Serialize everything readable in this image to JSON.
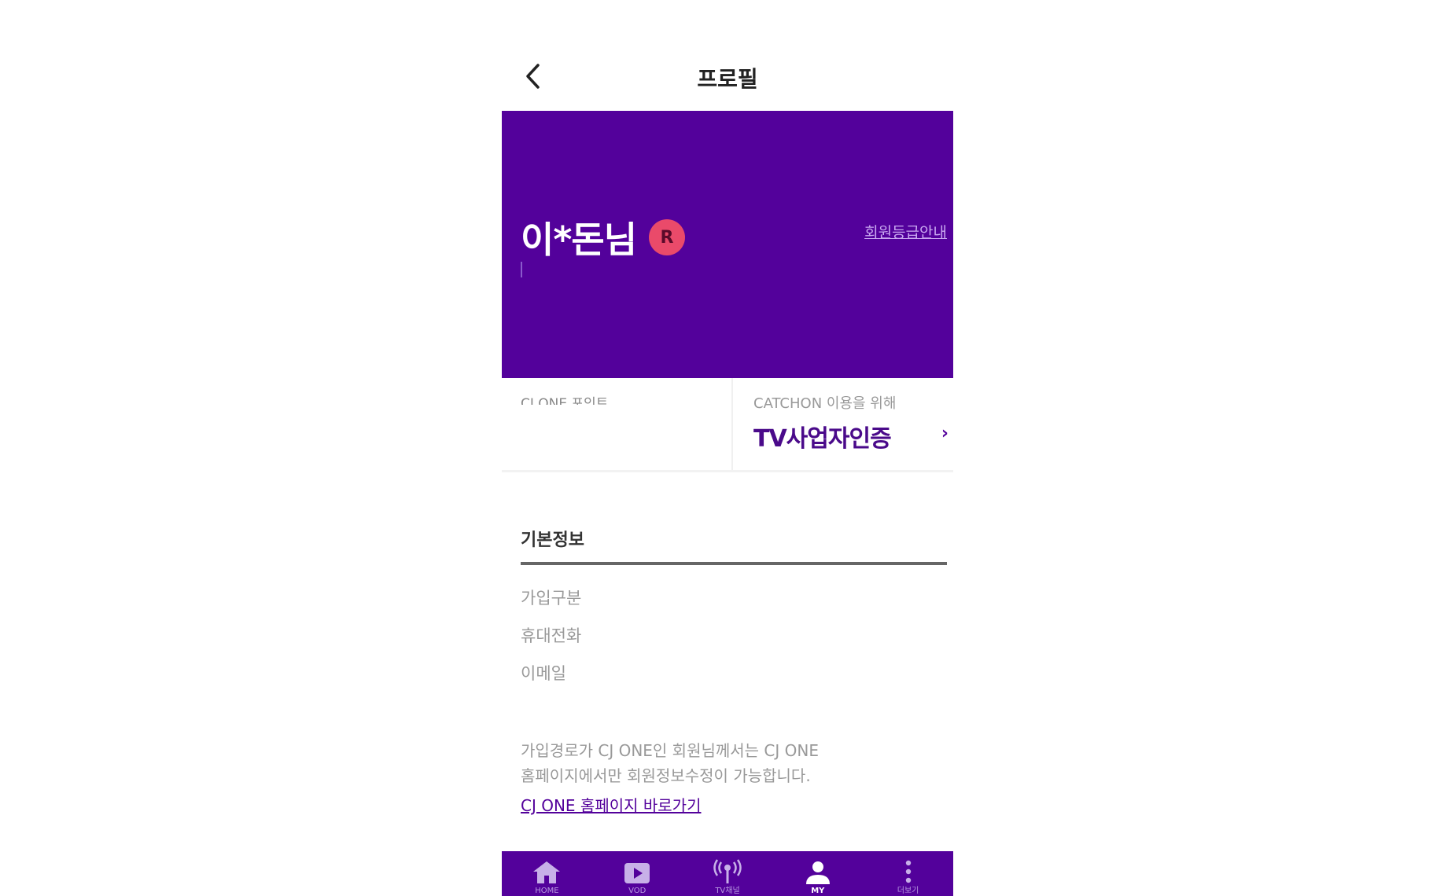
{
  "header": {
    "title": "프로필",
    "back_icon": "chevron-left-icon"
  },
  "banner": {
    "user_name": "이*돈님",
    "grade_badge": "R",
    "grade_guide": "회원등급안내",
    "background_color": "#53019b"
  },
  "cards": {
    "left_label": "CJ ONE 포인트",
    "right_label": "CATCHON 이용을 위해",
    "right_value": "TV사업자인증",
    "right_chevron": "›"
  },
  "basic_info": {
    "title": "기본정보",
    "items": [
      "가입구분",
      "휴대전화",
      "이메일"
    ]
  },
  "notice": {
    "line1": "가입경로가 CJ ONE인 회원님께서는 CJ ONE",
    "line2": "홈페이지에서만 회원정보수정이 가능합니다.",
    "link": "CJ ONE 홈페이지 바로가기"
  },
  "bottom_nav": {
    "items": [
      {
        "label": "HOME",
        "icon": "home-icon"
      },
      {
        "label": "VOD",
        "icon": "vod-icon"
      },
      {
        "label": "TV채널",
        "icon": "tv-channel-icon"
      },
      {
        "label": "MY",
        "icon": "user-icon"
      },
      {
        "label": "더보기",
        "icon": "more-vertical-icon"
      }
    ]
  }
}
